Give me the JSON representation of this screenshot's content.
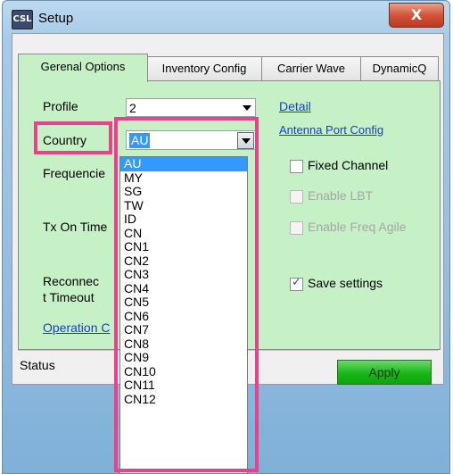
{
  "window": {
    "title": "Setup",
    "app_icon_text": "CSL",
    "close_label": "X"
  },
  "tabs": [
    {
      "label": "Gerenal Options",
      "active": true
    },
    {
      "label": "Inventory Config",
      "active": false
    },
    {
      "label": "Carrier Wave",
      "active": false
    },
    {
      "label": "DynamicQ",
      "active": false
    }
  ],
  "form": {
    "profile_label": "Profile",
    "profile_value": "2",
    "country_label": "Country",
    "country_value": "AU",
    "frequencies_label": "Frequencie",
    "tx_on_time_label": "Tx On Time",
    "reconnect_label_line1": "Reconnec",
    "reconnect_label_line2": "t Timeout",
    "operation_link": "Operation C",
    "detail_link": "Detail",
    "antenna_link": "Antenna Port Config",
    "fixed_channel": {
      "label": "Fixed Channel",
      "checked": false,
      "enabled": true
    },
    "enable_lbt": {
      "label": "Enable LBT",
      "checked": false,
      "enabled": false
    },
    "enable_freq_agile": {
      "label": "Enable Freq Agile",
      "checked": false,
      "enabled": false
    },
    "save_settings": {
      "label": "Save settings",
      "checked": true,
      "enabled": true
    }
  },
  "status": {
    "label": "Status",
    "apply_label": "Apply"
  },
  "country_dropdown": {
    "selected": "AU",
    "options": [
      "AU",
      "MY",
      "SG",
      "TW",
      "ID",
      "CN",
      "CN1",
      "CN2",
      "CN3",
      "CN4",
      "CN5",
      "CN6",
      "CN7",
      "CN8",
      "CN9",
      "CN10",
      "CN11",
      "CN12"
    ]
  },
  "colors": {
    "panel_bg": "#c6f0c6",
    "highlight": "#e8428a",
    "selection": "#3399ff",
    "apply_bg": "#19b719"
  }
}
